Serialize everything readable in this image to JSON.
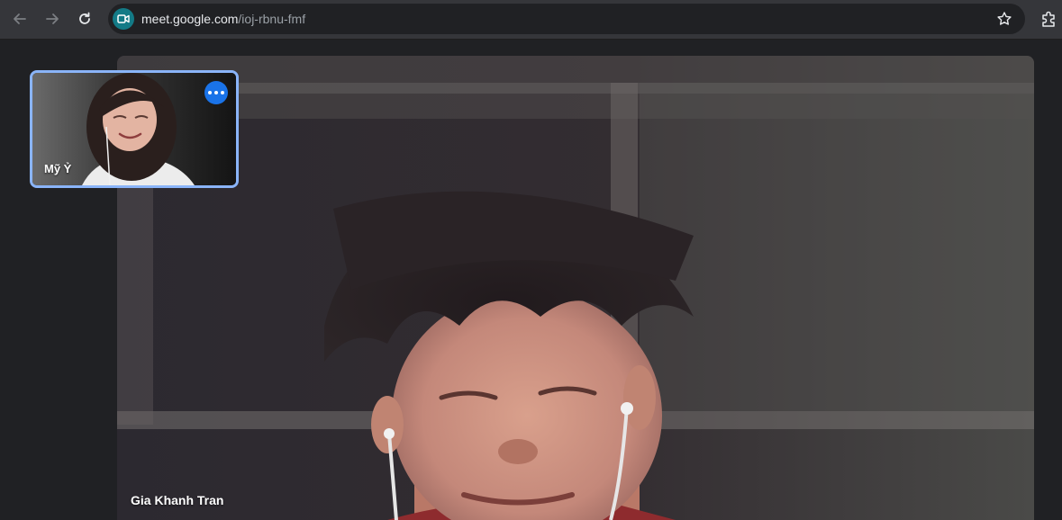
{
  "browser": {
    "url_host": "meet.google.com",
    "url_path": "/ioj-rbnu-fmf",
    "icons": {
      "back": "arrow-left-icon",
      "forward": "arrow-right-icon",
      "reload": "reload-icon",
      "site": "google-meet-icon",
      "bookmark": "star-icon",
      "extensions": "puzzle-piece-icon"
    }
  },
  "meet": {
    "self_tile": {
      "name": "Mỹ Ỷ",
      "more_icon": "more-options-icon"
    },
    "main_tile": {
      "name": "Gia Khanh Tran"
    }
  },
  "colors": {
    "self_tile_border": "#8ab4f8",
    "more_button": "#1a73e8",
    "site_icon": "#137a86",
    "page_background": "#202124",
    "toolbar_background": "#35363a"
  }
}
